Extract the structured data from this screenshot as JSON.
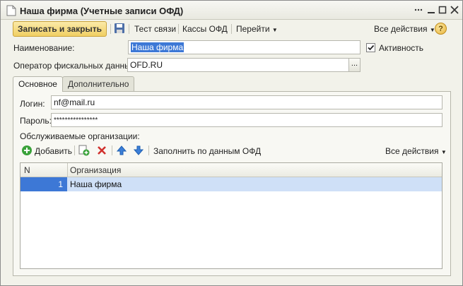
{
  "window": {
    "title": "Наша фирма (Учетные записи ОФД)"
  },
  "toolbar": {
    "save_close_label": "Записать и закрыть",
    "test_connection_label": "Тест связи",
    "ofd_registers_label": "Кассы ОФД",
    "goto_label": "Перейти",
    "all_actions_label": "Все действия",
    "help_label": "?"
  },
  "form": {
    "name_label": "Наименование:",
    "name_value": "Наша фирма",
    "active_label": "Активность",
    "active_checked": true,
    "operator_label": "Оператор фискальных данных:",
    "operator_value": "OFD.RU",
    "operator_select_label": "..."
  },
  "tabs": [
    {
      "label": "Основное",
      "active": true
    },
    {
      "label": "Дополнительно",
      "active": false
    }
  ],
  "main": {
    "login_label": "Логин:",
    "login_value": "nf@mail.ru",
    "password_label": "Пароль:",
    "password_value": "****************",
    "orgs_label": "Обслуживаемые организации:",
    "add_label": "Добавить",
    "fill_label": "Заполнить по данным ОФД",
    "all_actions_label": "Все действия"
  },
  "table": {
    "columns": [
      "N",
      "Организация"
    ],
    "rows": [
      {
        "n": "1",
        "org": "Наша фирма"
      }
    ]
  },
  "colors": {
    "accent": "#f0cf63",
    "selection": "#3d78d6",
    "row_highlight": "#cfe0f7",
    "delete_icon": "#d0312d",
    "arrow_icon": "#3c7fd8",
    "add_icon": "#3aa23a"
  },
  "icons": [
    "document-icon",
    "save-icon",
    "help-icon",
    "add-icon",
    "copy-add-icon",
    "delete-icon",
    "move-up-icon",
    "move-down-icon",
    "chevron-down-icon",
    "checkmark-icon"
  ]
}
